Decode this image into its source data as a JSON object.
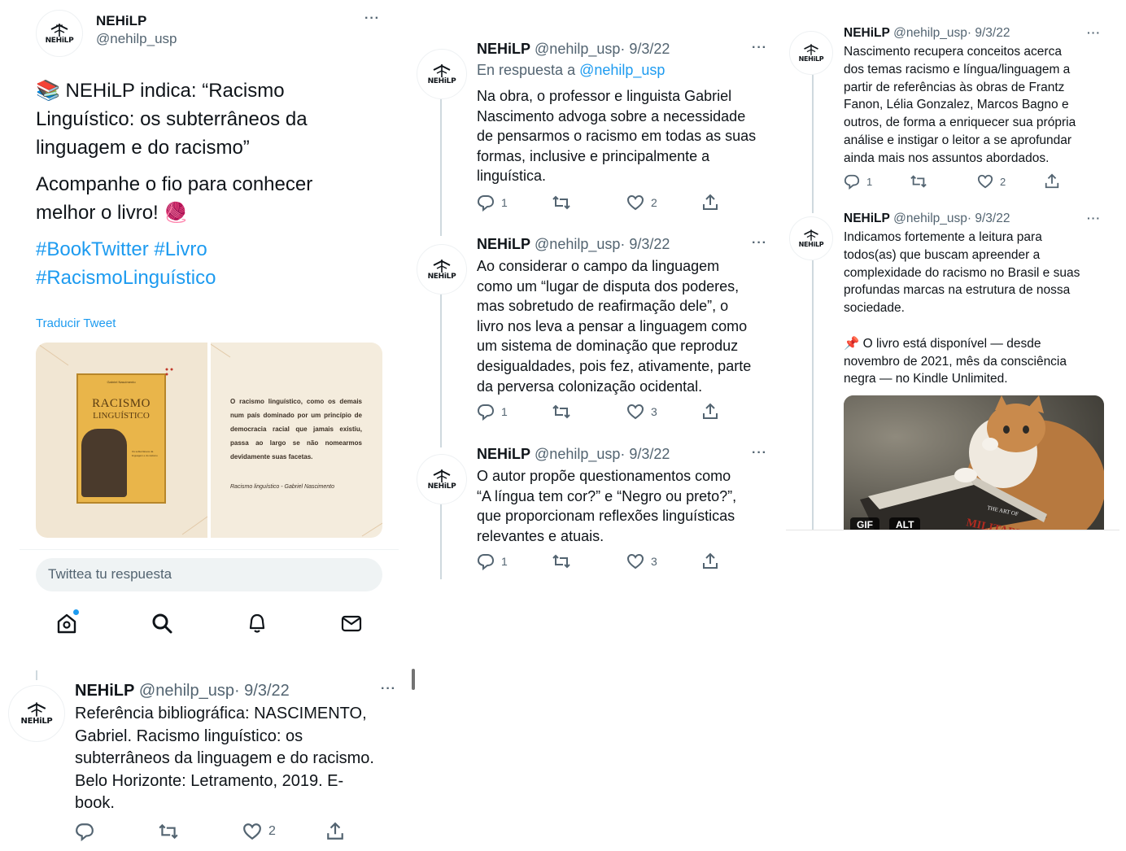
{
  "main_tweet": {
    "avatar_text": "NEHiLP",
    "name": "NEHiLP",
    "handle": "@nehilp_usp",
    "more": "···",
    "emoji_books": "📚",
    "text_line1": " NEHiLP indica: “Racismo",
    "text_line2": "Linguístico: os subterrâneos da",
    "text_line3": "linguagem e do racismo”",
    "text_line4": "Acompanhe o fio para conhecer",
    "text_line5": "melhor o livro! ",
    "emoji_yarn": "🧶",
    "hashtag1": "#BookTwitter",
    "hashtag2": "#Livro",
    "hashtag3": "#RacismoLinguístico",
    "translate": "Traducir Tweet",
    "book_cover": {
      "author": "Gabriel Nascimento",
      "title_line1": "RACISMO",
      "title_line2": "LINGUÍSTICO",
      "subtitle": "Os subterrâneos da linguagem e do racismo"
    },
    "quote_card": {
      "quote": "O racismo linguístico, como os demais num país dominado por um princípio de democracia racial que jamais existiu, passa ao largo se não nomearmos devidamente suas facetas.",
      "source": "Racismo linguístico - Gabriel Nascimento"
    },
    "reply_placeholder": "Twittea tu respuesta"
  },
  "bottom_nav": {
    "home_icon": "home-icon",
    "search_icon": "search-icon",
    "notifications_icon": "bell-icon",
    "messages_icon": "envelope-icon"
  },
  "thread": [
    {
      "name": "NEHiLP",
      "handle": "@nehilp_usp",
      "date": "· 9/3/22",
      "reply_to_prefix": "En respuesta a ",
      "reply_to_handle": "@nehilp_usp",
      "lines": [
        "Na obra, o professor e linguista Gabriel",
        "Nascimento advoga sobre a necessidade",
        "de pensarmos o racismo em todas as suas",
        "formas, inclusive e principalmente a",
        "linguística."
      ],
      "replies": "1",
      "retweets": "",
      "likes": "2"
    },
    {
      "name": "NEHiLP",
      "handle": "@nehilp_usp",
      "date": "· 9/3/22",
      "lines": [
        "Ao considerar o campo da linguagem",
        "como um “lugar de disputa dos poderes,",
        "mas sobretudo de reafirmação dele”, o",
        "livro nos leva a pensar a linguagem como",
        "um sistema de dominação que reproduz",
        "desigualdades, pois fez, ativamente, parte",
        "da perversa colonização ocidental."
      ],
      "replies": "1",
      "retweets": "",
      "likes": "3"
    },
    {
      "name": "NEHiLP",
      "handle": "@nehilp_usp",
      "date": "· 9/3/22",
      "lines": [
        "O autor propõe questionamentos como",
        "“A língua tem cor?” e “Negro ou preto?”,",
        "que proporcionam reflexões linguísticas",
        "relevantes e atuais."
      ],
      "replies": "1",
      "retweets": "",
      "likes": "3"
    }
  ],
  "right_thread": [
    {
      "name": "NEHiLP",
      "handle": "@nehilp_usp",
      "date": "· 9/3/22",
      "lines": [
        "Nascimento recupera conceitos acerca",
        "dos temas racismo e língua/linguagem a",
        "partir de referências às obras de Frantz",
        "Fanon, Lélia Gonzalez, Marcos Bagno e",
        "outros, de forma a enriquecer sua própria",
        "análise e instigar o leitor a se aprofundar",
        "ainda mais nos assuntos abordados."
      ],
      "replies": "1",
      "retweets": "",
      "likes": "2"
    },
    {
      "name": "NEHiLP",
      "handle": "@nehilp_usp",
      "date": "· 9/3/22",
      "lines": [
        "Indicamos fortemente a leitura para",
        "todos(as) que buscam apreender a",
        "complexidade do racismo no Brasil e suas",
        "profundas marcas na estrutura de nossa",
        "sociedade."
      ],
      "pin_emoji": "📌",
      "lines2": [
        " O livro está disponível — desde",
        "novembro de 2021, mês da consciência",
        "negra — no Kindle Unlimited."
      ],
      "gif_badge": "GIF",
      "alt_badge": "ALT",
      "gif_book_text1": "THE ART OF",
      "gif_book_text2": "MILITARY STRATEGY"
    }
  ],
  "bottom_tweet": {
    "name": "NEHiLP",
    "handle": "@nehilp_usp",
    "date": "· 9/3/22",
    "lines": [
      "Referência bibliográfica: NASCIMENTO,",
      "Gabriel. Racismo linguístico: os",
      "subterrâneos da linguagem e do racismo.",
      "Belo Horizonte: Letramento, 2019. E-",
      "book."
    ],
    "replies": "",
    "retweets": "",
    "likes": "2"
  },
  "colors": {
    "accent": "#1d9bf0",
    "muted": "#536471",
    "text": "#0f1419",
    "thread_line": "#cfd9de",
    "card_bg": "#f3ead9"
  }
}
